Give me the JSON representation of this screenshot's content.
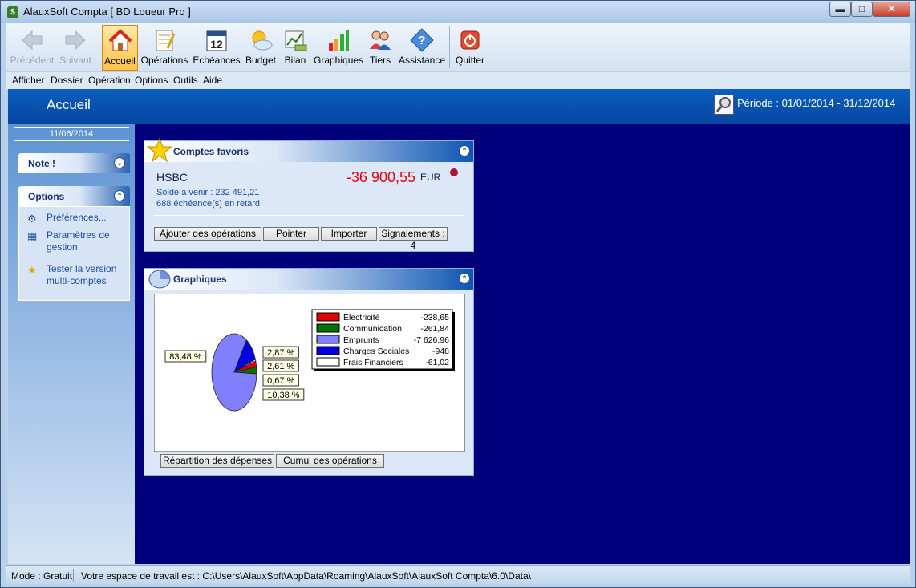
{
  "window": {
    "title": "AlauxSoft Compta [ BD Loueur Pro ]",
    "minimize_glyph": "▬",
    "maximize_glyph": "□",
    "close_glyph": "✕"
  },
  "toolbar": {
    "items": [
      {
        "label": "Précédent",
        "icon": "back-arrow-icon"
      },
      {
        "label": "Suivant",
        "icon": "forward-arrow-icon"
      },
      {
        "label": "Accueil",
        "icon": "home-icon"
      },
      {
        "label": "Opérations",
        "icon": "notepad-icon"
      },
      {
        "label": "Echéances",
        "icon": "calendar-icon"
      },
      {
        "label": "Budget",
        "icon": "sun-cloud-icon"
      },
      {
        "label": "Bilan",
        "icon": "chart-money-icon"
      },
      {
        "label": "Graphiques",
        "icon": "bar-chart-icon"
      },
      {
        "label": "Tiers",
        "icon": "people-icon"
      },
      {
        "label": "Assistance",
        "icon": "help-diamond-icon"
      },
      {
        "label": "Quitter",
        "icon": "power-icon"
      }
    ],
    "calendar_day": "12"
  },
  "menubar": [
    "Afficher",
    "Dossier",
    "Opération",
    "Options",
    "Outils",
    "Aide"
  ],
  "header": {
    "title": "Accueil",
    "period": "Période : 01/01/2014 - 31/12/2014"
  },
  "sidebar": {
    "date": "11/06/2014",
    "note_label": "Note !",
    "options_label": "Options",
    "links": [
      {
        "label": "Préférences...",
        "icon": "preferences-icon"
      },
      {
        "label": "Paramètres de gestion",
        "icon": "calendar-grid-icon"
      },
      {
        "label": "Tester la version multi-comptes",
        "icon": "star-icon"
      }
    ]
  },
  "favoris": {
    "title": "Comptes favoris",
    "bank": "HSBC",
    "balance": "-36 900,55",
    "currency": "EUR",
    "solde_a_venir": "Solde à venir : 232 491,21",
    "retard": "688 échéance(s) en retard",
    "buttons": [
      "Ajouter des opérations",
      "Pointer",
      "Importer",
      "Signalements : 4"
    ],
    "status_color": "#b0123a"
  },
  "graphiques": {
    "title": "Graphiques",
    "tabs": [
      "Répartition des dépenses",
      "Cumul des opérations"
    ]
  },
  "chart_data": {
    "type": "pie",
    "categories": [
      "Electricité",
      "Communication",
      "Emprunts",
      "Charges Sociales",
      "Frais Financiers"
    ],
    "values": [
      -238.65,
      -261.84,
      -7626.96,
      -948,
      -61.02
    ],
    "value_labels": [
      "-238,65",
      "-261,84",
      "-7 626,96",
      "-948",
      "-61,02"
    ],
    "percent_labels": [
      "2,61 %",
      "2,87 %",
      "83,48 %",
      "10,38 %",
      "0,67 %"
    ],
    "colors": [
      "#e00000",
      "#007000",
      "#8080ff",
      "#0000e0",
      "#ffffff"
    ],
    "legend": "right"
  },
  "status": {
    "mode": "Mode : Gratuit",
    "workspace": "Votre espace de travail est : C:\\Users\\AlauxSoft\\AppData\\Roaming\\AlauxSoft\\AlauxSoft Compta\\6.0\\Data\\"
  }
}
